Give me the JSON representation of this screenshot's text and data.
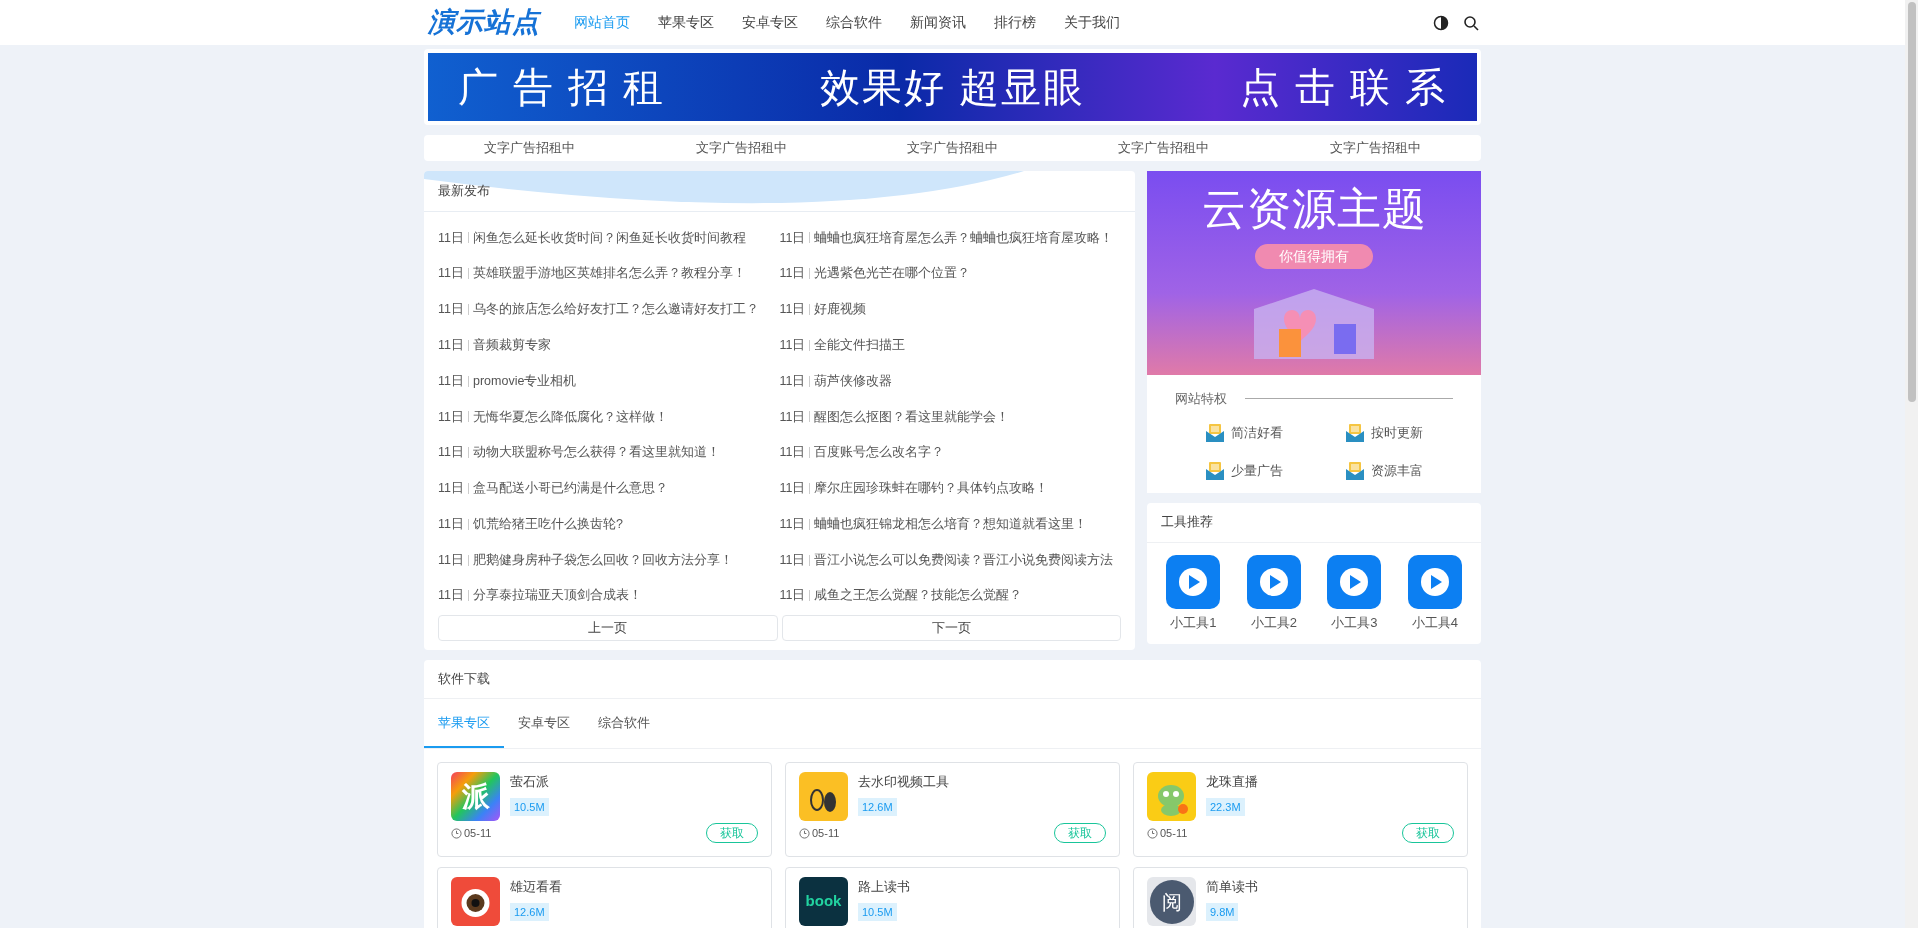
{
  "header": {
    "logo": "演示站点",
    "nav": [
      {
        "label": "网站首页",
        "selected": true
      },
      {
        "label": "苹果专区",
        "selected": false
      },
      {
        "label": "安卓专区",
        "selected": false
      },
      {
        "label": "综合软件",
        "selected": false
      },
      {
        "label": "新闻资讯",
        "selected": false
      },
      {
        "label": "排行榜",
        "selected": false
      },
      {
        "label": "关于我们",
        "selected": false
      }
    ]
  },
  "banner": {
    "texts": [
      "广 告 招 租",
      "效果好 超显眼",
      "点 击 联 系"
    ]
  },
  "text_ads": [
    "文字广告招租中",
    "文字广告招租中",
    "文字广告招租中",
    "文字广告招租中",
    "文字广告招租中"
  ],
  "latest": {
    "title": "最新发布",
    "items": [
      {
        "date": "11日",
        "title": "闲鱼怎么延长收货时间？闲鱼延长收货时间教程"
      },
      {
        "date": "11日",
        "title": "蛐蛐也疯狂培育屋怎么弄？蛐蛐也疯狂培育屋攻略！"
      },
      {
        "date": "11日",
        "title": "英雄联盟手游地区英雄排名怎么弄？教程分享！"
      },
      {
        "date": "11日",
        "title": "光遇紫色光芒在哪个位置？"
      },
      {
        "date": "11日",
        "title": "乌冬的旅店怎么给好友打工？怎么邀请好友打工？"
      },
      {
        "date": "11日",
        "title": "好鹿视频"
      },
      {
        "date": "11日",
        "title": "音频裁剪专家"
      },
      {
        "date": "11日",
        "title": "全能文件扫描王"
      },
      {
        "date": "11日",
        "title": "promovie专业相机"
      },
      {
        "date": "11日",
        "title": "葫芦侠修改器"
      },
      {
        "date": "11日",
        "title": "无悔华夏怎么降低腐化？这样做！"
      },
      {
        "date": "11日",
        "title": "醒图怎么抠图？看这里就能学会！"
      },
      {
        "date": "11日",
        "title": "动物大联盟称号怎么获得？看这里就知道！"
      },
      {
        "date": "11日",
        "title": "百度账号怎么改名字？"
      },
      {
        "date": "11日",
        "title": "盒马配送小哥已约满是什么意思？"
      },
      {
        "date": "11日",
        "title": "摩尔庄园珍珠蚌在哪钓？具体钓点攻略！"
      },
      {
        "date": "11日",
        "title": "饥荒给猪王吃什么换齿轮?"
      },
      {
        "date": "11日",
        "title": "蛐蛐也疯狂锦龙相怎么培育？想知道就看这里！"
      },
      {
        "date": "11日",
        "title": "肥鹅健身房种子袋怎么回收？回收方法分享！"
      },
      {
        "date": "11日",
        "title": "晋江小说怎么可以免费阅读？晋江小说免费阅读方法"
      },
      {
        "date": "11日",
        "title": "分享泰拉瑞亚天顶剑合成表！"
      },
      {
        "date": "11日",
        "title": "咸鱼之王怎么觉醒？技能怎么觉醒？"
      }
    ],
    "pager": [
      "上一页",
      "下一页"
    ]
  },
  "promo": {
    "title": "云资源主题",
    "tagline": "你值得拥有"
  },
  "privileges": {
    "title": "网站特权",
    "items": [
      "简洁好看",
      "按时更新",
      "少量广告",
      "资源丰富"
    ]
  },
  "tools": {
    "title": "工具推荐",
    "items": [
      "小工具1",
      "小工具2",
      "小工具3",
      "小工具4"
    ]
  },
  "software": {
    "title": "软件下载",
    "tabs": [
      {
        "label": "苹果专区",
        "selected": true
      },
      {
        "label": "安卓专区",
        "selected": false
      },
      {
        "label": "综合软件",
        "selected": false
      }
    ],
    "apps": [
      {
        "kind": "rainbow",
        "glyph": "派",
        "name": "萤石派",
        "size": "10.5M",
        "date": "05-11",
        "action": "获取"
      },
      {
        "kind": "feet",
        "name": "去水印视频工具",
        "size": "12.6M",
        "date": "05-11",
        "action": "获取"
      },
      {
        "kind": "dragon",
        "name": "龙珠直播",
        "size": "22.3M",
        "date": "05-11",
        "action": "获取"
      },
      {
        "kind": "eye",
        "name": "雄迈看看",
        "size": "12.6M"
      },
      {
        "kind": "book",
        "glyph": "book",
        "name": "路上读书",
        "size": "10.5M"
      },
      {
        "kind": "circle",
        "glyph": "阅",
        "name": "简单读书",
        "size": "9.8M"
      }
    ]
  }
}
